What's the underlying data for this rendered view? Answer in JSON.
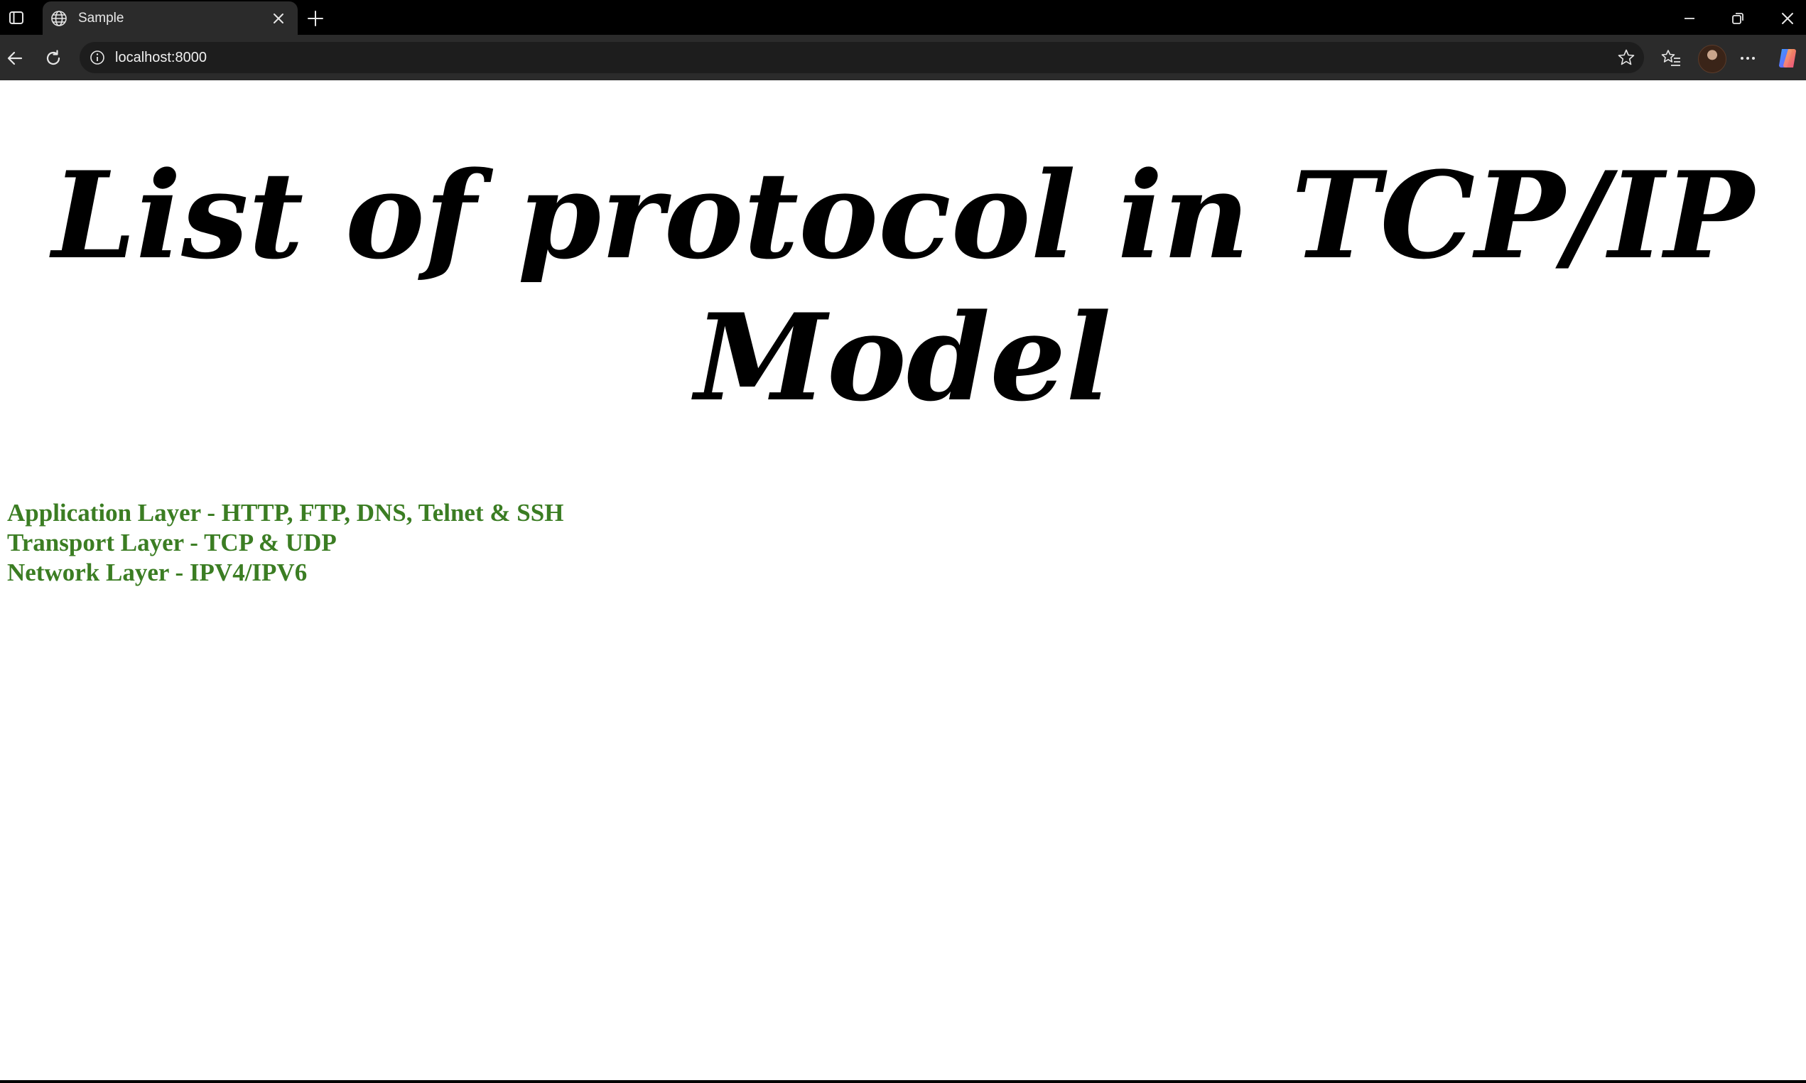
{
  "browser": {
    "tab_title": "Sample",
    "url": "localhost:8000",
    "colors": {
      "chrome_bg": "#000000",
      "toolbar_bg": "#2b2b2b",
      "omnibox_bg": "#1d1d1d"
    },
    "icons": [
      "tab-actions-icon",
      "globe-icon",
      "close-icon",
      "plus-icon",
      "minimize-icon",
      "restore-icon",
      "back-icon",
      "reload-icon",
      "info-icon",
      "star-icon",
      "favorites-icon",
      "more-icon",
      "copilot-icon"
    ]
  },
  "page": {
    "title": "List of protocol in TCP/IP Model",
    "title_color": "#000000",
    "items": [
      "Application Layer - HTTP, FTP, DNS, Telnet & SSH",
      "Transport Layer - TCP & UDP",
      "Network Layer - IPV4/IPV6"
    ],
    "item_color": "#3b7d23"
  }
}
